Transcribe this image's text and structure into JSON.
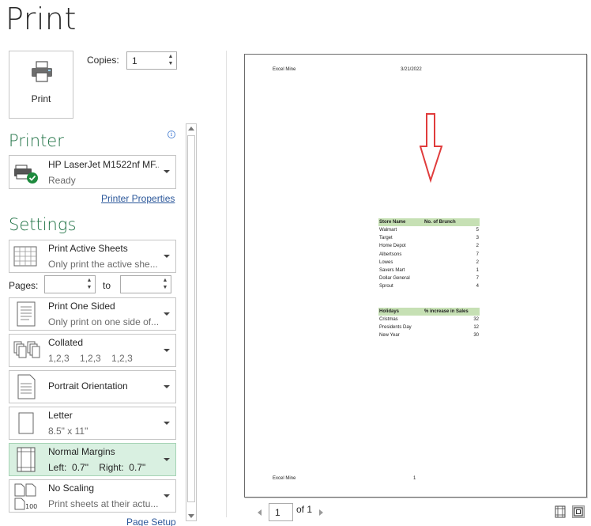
{
  "header": {
    "title": "Print"
  },
  "print_button": {
    "label": "Print"
  },
  "copies": {
    "label": "Copies:",
    "value": "1"
  },
  "printer": {
    "section_title": "Printer",
    "name": "HP LaserJet M1522nf MF...",
    "status": "Ready",
    "properties_link": "Printer Properties"
  },
  "settings": {
    "section_title": "Settings",
    "items": [
      {
        "title": "Print Active Sheets",
        "subtitle": "Only print the active she..."
      },
      {
        "title": "Print One Sided",
        "subtitle": "Only print on one side of..."
      },
      {
        "title": "Collated",
        "subtitle": "1,2,3    1,2,3    1,2,3"
      },
      {
        "title": "Portrait Orientation",
        "subtitle": ""
      },
      {
        "title": "Letter",
        "subtitle": "8.5\" x 11\""
      },
      {
        "title": "Normal Margins",
        "subtitle": "Left:  0.7\"    Right:  0.7\""
      },
      {
        "title": "No Scaling",
        "subtitle": "Print sheets at their actu..."
      }
    ],
    "pages_label": "Pages:",
    "to_label": "to",
    "pages_from": "",
    "pages_to": "",
    "page_setup_link": "Page Setup"
  },
  "preview": {
    "header_left": "Excel Mine",
    "header_right": "3/21/2022",
    "footer_left": "Excel Mine",
    "footer_center": "1",
    "table1": {
      "headers": [
        "Store Name",
        "No. of Brunch"
      ],
      "rows": [
        [
          "Walmart",
          "5"
        ],
        [
          "Target",
          "3"
        ],
        [
          "Home Depot",
          "2"
        ],
        [
          "Albertsons",
          "7"
        ],
        [
          "Lowes",
          "2"
        ],
        [
          "Savers Mart",
          "1"
        ],
        [
          "Dollar General",
          "7"
        ],
        [
          "Sprout",
          "4"
        ]
      ]
    },
    "table2": {
      "headers": [
        "Holidays",
        "% increase in Sales"
      ],
      "rows": [
        [
          "Cristmas",
          "32"
        ],
        [
          "Presidents Day",
          "12"
        ],
        [
          "New Year",
          "30"
        ]
      ]
    }
  },
  "navigation": {
    "current_page": "1",
    "of_label": "of 1"
  },
  "colors": {
    "accent": "#217346",
    "selected_bg": "#d9f0e1",
    "table_header": "#c6e0b4",
    "arrow": "#e03c3c"
  }
}
